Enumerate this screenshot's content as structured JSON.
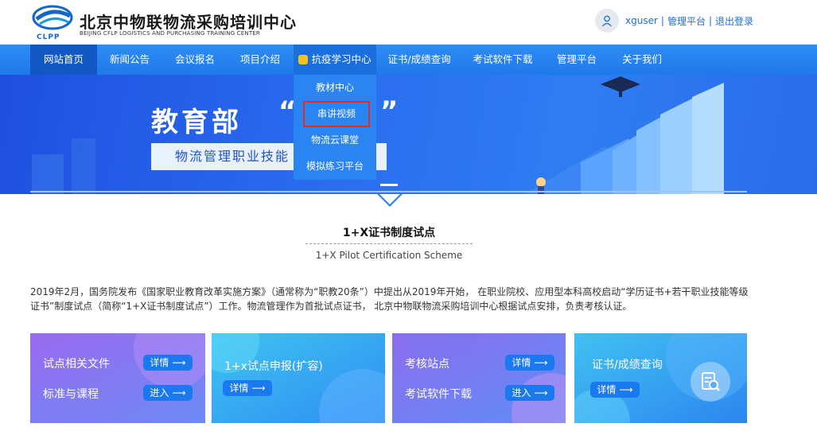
{
  "header": {
    "logo_cn": "北京中物联物流采购培训中心",
    "logo_en": "BEIJING CFLP LOGISTICS AND PURCHASING TRAINING CENTER",
    "logo_mark_text": "CLPP",
    "username": "xguser",
    "separator": "|",
    "admin_link": "管理平台",
    "logout_link": "退出登录"
  },
  "nav": {
    "items": [
      {
        "label": "网站首页"
      },
      {
        "label": "新闻公告"
      },
      {
        "label": "会议报名"
      },
      {
        "label": "项目介绍"
      },
      {
        "label": "抗疫学习中心"
      },
      {
        "label": "证书/成绩查询"
      },
      {
        "label": "考试软件下载"
      },
      {
        "label": "管理平台"
      },
      {
        "label": "关于我们"
      }
    ],
    "dropdown": [
      {
        "label": "教材中心"
      },
      {
        "label": "串讲视频"
      },
      {
        "label": "物流云课堂"
      },
      {
        "label": "模拟练习平台"
      }
    ]
  },
  "banner": {
    "title": "教育部",
    "quote_open": "“",
    "quote_close": "”",
    "subtitle": "物流管理职业技能"
  },
  "section": {
    "title": "1+X证书制度试点",
    "subtitle_en": "1+X Pilot Certification Scheme",
    "intro": "2019年2月，国务院发布《国家职业教育改革实施方案》（通常称为“职教20条”）中提出从2019年开始， 在职业院校、应用型本科高校启动“学历证书+若干职业技能等级证书”制度试点（简称“1+X证书制度试点”）工作。物流管理作为首批试点证书， 北京中物联物流采购培训中心根据试点安排，负责考核认证。"
  },
  "cards": [
    {
      "label1": "试点相关文件",
      "btn1": "详情",
      "label2": "标准与课程",
      "btn2": "进入"
    },
    {
      "label1": "1+x试点申报(扩容)",
      "btn1": "详情"
    },
    {
      "label1": "考核站点",
      "btn1": "详情",
      "label2": "考试软件下载",
      "btn2": "进入"
    },
    {
      "label1": "证书/成绩查询",
      "btn1": "详情"
    }
  ],
  "arrow": "⟶",
  "colors": {
    "nav": "#2f8cf5",
    "nav_active": "#1258c5",
    "link": "#1d6fd6",
    "pill": "#1b79f0",
    "highlight_border": "#e02b2b"
  }
}
